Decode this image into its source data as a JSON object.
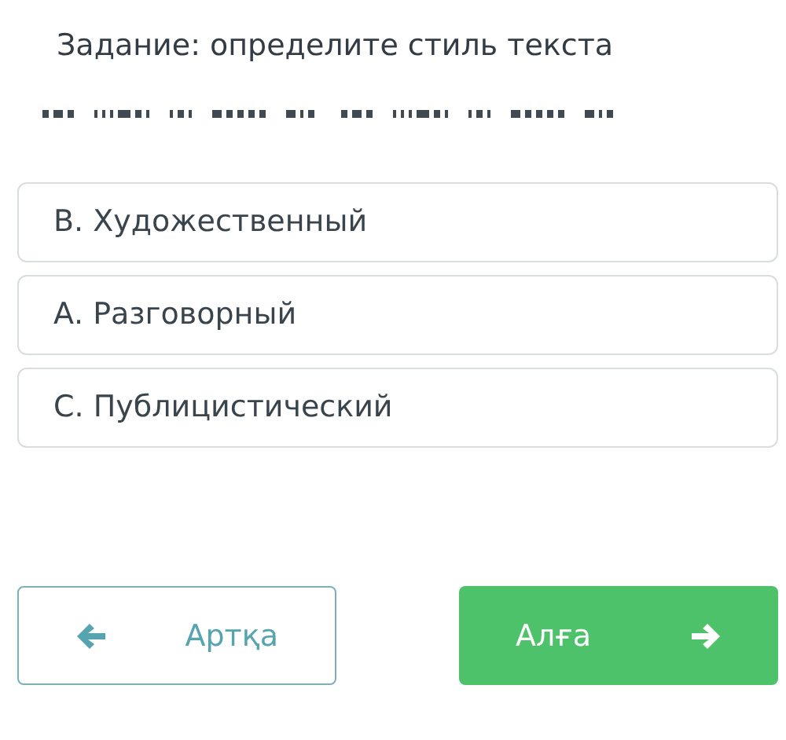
{
  "task": {
    "title": "Задание: определите стиль текста"
  },
  "options": [
    "В. Художественный",
    "А. Разговорный",
    "С. Публицистический"
  ],
  "buttons": [
    {
      "kind": "back",
      "label": "Артқа"
    },
    {
      "kind": "next",
      "label": "Алға"
    }
  ]
}
